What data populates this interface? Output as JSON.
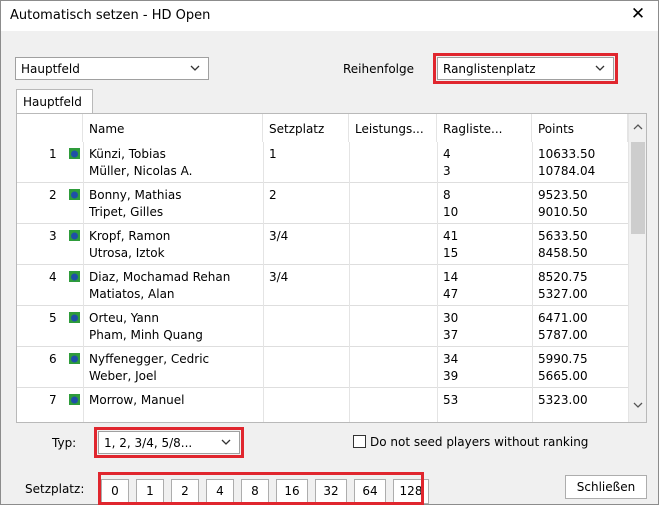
{
  "window": {
    "title": "Automatisch setzen - HD Open",
    "close_glyph": "✕"
  },
  "field_select": {
    "value": "Hauptfeld"
  },
  "order": {
    "label": "Reihenfolge",
    "value": "Ranglistenplatz"
  },
  "tabs": [
    {
      "label": "Hauptfeld"
    }
  ],
  "table": {
    "columns": [
      "Name",
      "Setzplatz",
      "Leistungs...",
      "Ragliste...",
      "Points"
    ],
    "rows": [
      {
        "number": "1",
        "players": [
          "Künzi, Tobias",
          "Müller, Nicolas A."
        ],
        "seed": "1",
        "performance": "",
        "ranking": [
          "4",
          "3"
        ],
        "points": [
          "10633.50",
          "10784.04"
        ]
      },
      {
        "number": "2",
        "players": [
          "Bonny, Mathias",
          "Tripet, Gilles"
        ],
        "seed": "2",
        "performance": "",
        "ranking": [
          "8",
          "10"
        ],
        "points": [
          "9523.50",
          "9010.50"
        ]
      },
      {
        "number": "3",
        "players": [
          "Kropf, Ramon",
          "Utrosa, Iztok"
        ],
        "seed": "3/4",
        "performance": "",
        "ranking": [
          "41",
          "15"
        ],
        "points": [
          "5633.50",
          "8458.50"
        ]
      },
      {
        "number": "4",
        "players": [
          "Diaz, Mochamad Rehan",
          "Matiatos, Alan"
        ],
        "seed": "3/4",
        "performance": "",
        "ranking": [
          "14",
          "47"
        ],
        "points": [
          "8520.75",
          "5327.00"
        ]
      },
      {
        "number": "5",
        "players": [
          "Orteu, Yann",
          "Pham, Minh Quang"
        ],
        "seed": "",
        "performance": "",
        "ranking": [
          "30",
          "37"
        ],
        "points": [
          "6471.00",
          "5787.00"
        ]
      },
      {
        "number": "6",
        "players": [
          "Nyffenegger, Cedric",
          "Weber, Joel"
        ],
        "seed": "",
        "performance": "",
        "ranking": [
          "34",
          "39"
        ],
        "points": [
          "5990.75",
          "5665.00"
        ]
      },
      {
        "number": "7",
        "players": [
          "Morrow, Manuel",
          ""
        ],
        "seed": "",
        "performance": "",
        "ranking": [
          "53",
          ""
        ],
        "points": [
          "5323.00",
          ""
        ]
      }
    ]
  },
  "typ": {
    "label": "Typ:",
    "value": "1, 2, 3/4, 5/8..."
  },
  "no_seed_checkbox": {
    "label": "Do not seed players without ranking",
    "checked": false
  },
  "setzplatz": {
    "label": "Setzplatz:",
    "buttons": [
      "0",
      "1",
      "2",
      "4",
      "8",
      "16",
      "32",
      "64",
      "128"
    ]
  },
  "close_button": {
    "label": "Schließen"
  },
  "colors": {
    "highlight": "#e0262e",
    "icon_green": "#2e9c3b",
    "icon_blue": "#1f4fa8"
  }
}
